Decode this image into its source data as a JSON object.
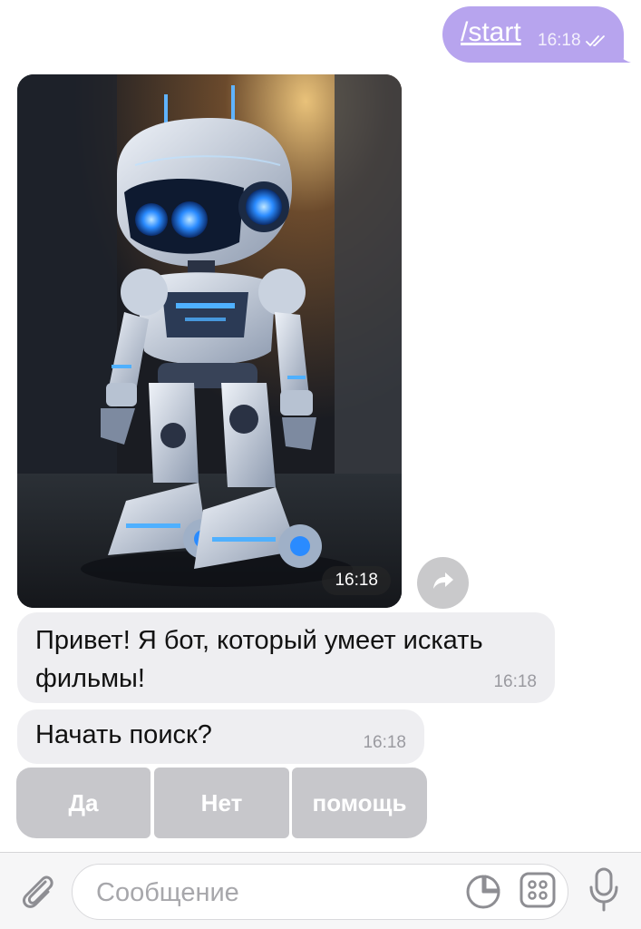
{
  "outgoing": {
    "text": "/start",
    "time": "16:18",
    "status_icon": "double-check-icon"
  },
  "photo": {
    "subject": "robot-image",
    "time": "16:18",
    "forward_icon": "forward-arrow-icon"
  },
  "incoming": [
    {
      "text": "Привет! Я бот, который умеет искать фильмы!",
      "time": "16:18"
    },
    {
      "text": "Начать поиск?",
      "time": "16:18"
    }
  ],
  "keyboard": [
    {
      "label": "Да"
    },
    {
      "label": "Нет"
    },
    {
      "label": "помощь"
    }
  ],
  "input_bar": {
    "placeholder": "Сообщение",
    "attach_icon": "paperclip-icon",
    "sticker_icon": "sticker-icon",
    "menu_icon": "bot-menu-icon",
    "mic_icon": "microphone-icon"
  },
  "colors": {
    "outgoing_bubble": "#b7a4ee",
    "incoming_bubble": "#eeeef1",
    "keyboard_button": "#c7c7cb",
    "input_bar_bg": "#f6f6f7"
  }
}
